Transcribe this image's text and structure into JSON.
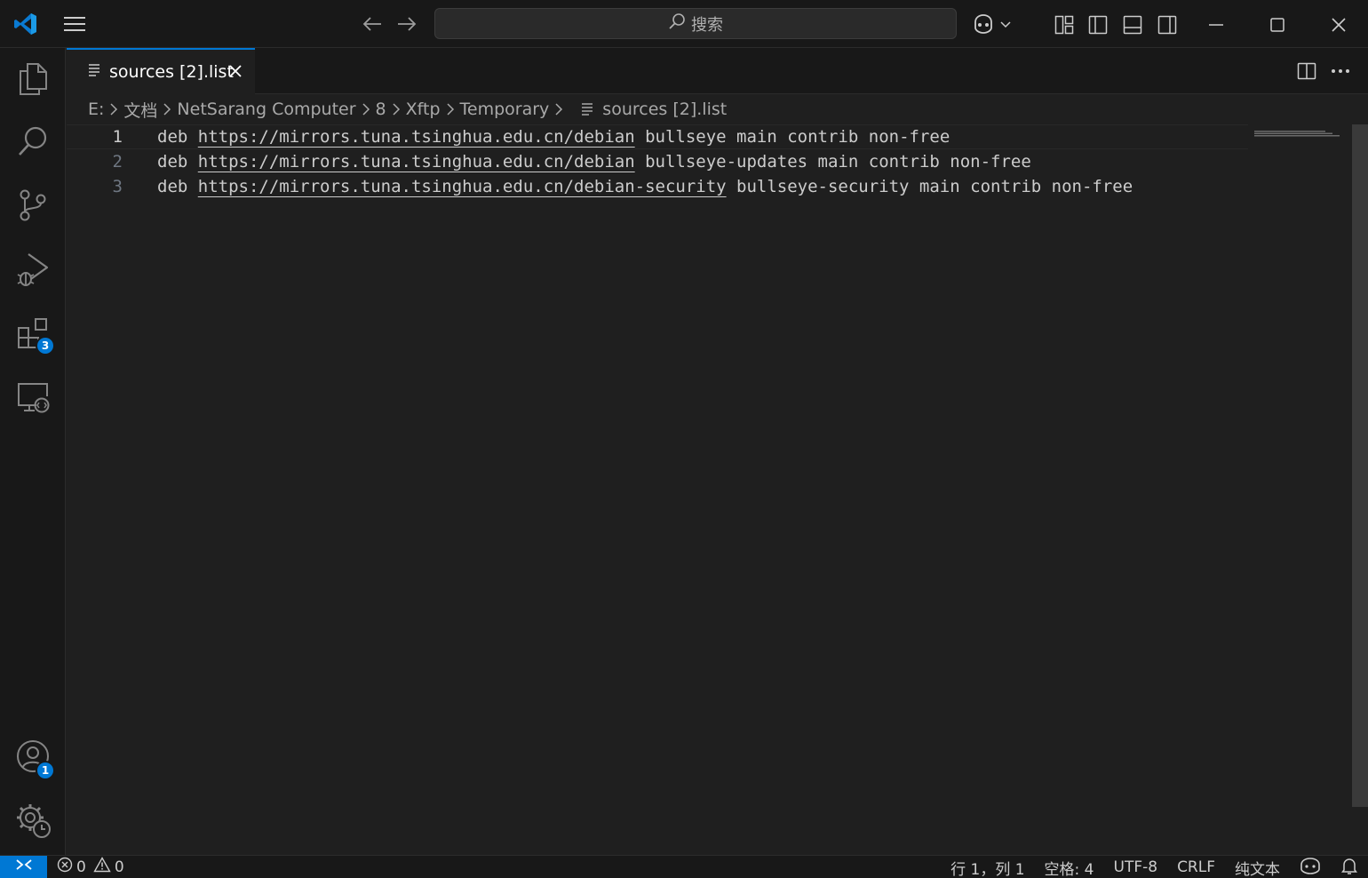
{
  "titlebar": {
    "app_icon": "vscode-logo-icon",
    "menu_icon": "hamburger-menu-icon",
    "search_placeholder": "搜索",
    "copilot_icon": "copilot-icon",
    "layout_icons": [
      "customize-layout-icon",
      "toggle-primary-sidebar-icon",
      "toggle-panel-icon",
      "toggle-secondary-sidebar-icon"
    ],
    "window_controls": [
      "minimize-icon",
      "maximize-icon",
      "close-icon"
    ]
  },
  "activitybar": {
    "items": [
      {
        "name": "explorer",
        "icon": "files-icon"
      },
      {
        "name": "search",
        "icon": "search-icon"
      },
      {
        "name": "source-control",
        "icon": "source-control-icon"
      },
      {
        "name": "run-debug",
        "icon": "run-debug-icon"
      },
      {
        "name": "extensions",
        "icon": "extensions-icon",
        "badge": "3"
      },
      {
        "name": "remote-explorer",
        "icon": "remote-explorer-icon"
      }
    ],
    "bottom": [
      {
        "name": "accounts",
        "icon": "account-icon",
        "badge": "1"
      },
      {
        "name": "manage",
        "icon": "gear-icon"
      }
    ]
  },
  "tabs": [
    {
      "label": "sources [2].list",
      "icon": "text-file-icon",
      "active": true
    }
  ],
  "editor_actions": [
    "split-editor-icon",
    "more-actions-icon"
  ],
  "breadcrumbs": {
    "parts": [
      "E:",
      "文档",
      "NetSarang Computer",
      "8",
      "Xftp",
      "Temporary"
    ],
    "file": "sources [2].list"
  },
  "editor": {
    "lines": [
      {
        "num": "1",
        "pre": "deb ",
        "link": "https://mirrors.tuna.tsinghua.edu.cn/debian",
        "post": " bullseye main contrib non-free"
      },
      {
        "num": "2",
        "pre": "deb ",
        "link": "https://mirrors.tuna.tsinghua.edu.cn/debian",
        "post": " bullseye-updates main contrib non-free"
      },
      {
        "num": "3",
        "pre": "deb ",
        "link": "https://mirrors.tuna.tsinghua.edu.cn/debian-security",
        "post": " bullseye-security main contrib non-free"
      }
    ],
    "current_line": "1"
  },
  "statusbar": {
    "errors": "0",
    "warnings": "0",
    "position": "行 1，列 1",
    "indent": "空格: 4",
    "encoding": "UTF-8",
    "eol": "CRLF",
    "language": "纯文本"
  },
  "colors": {
    "accent": "#0078d4",
    "background": "#1f1f1f",
    "chrome": "#181818"
  }
}
